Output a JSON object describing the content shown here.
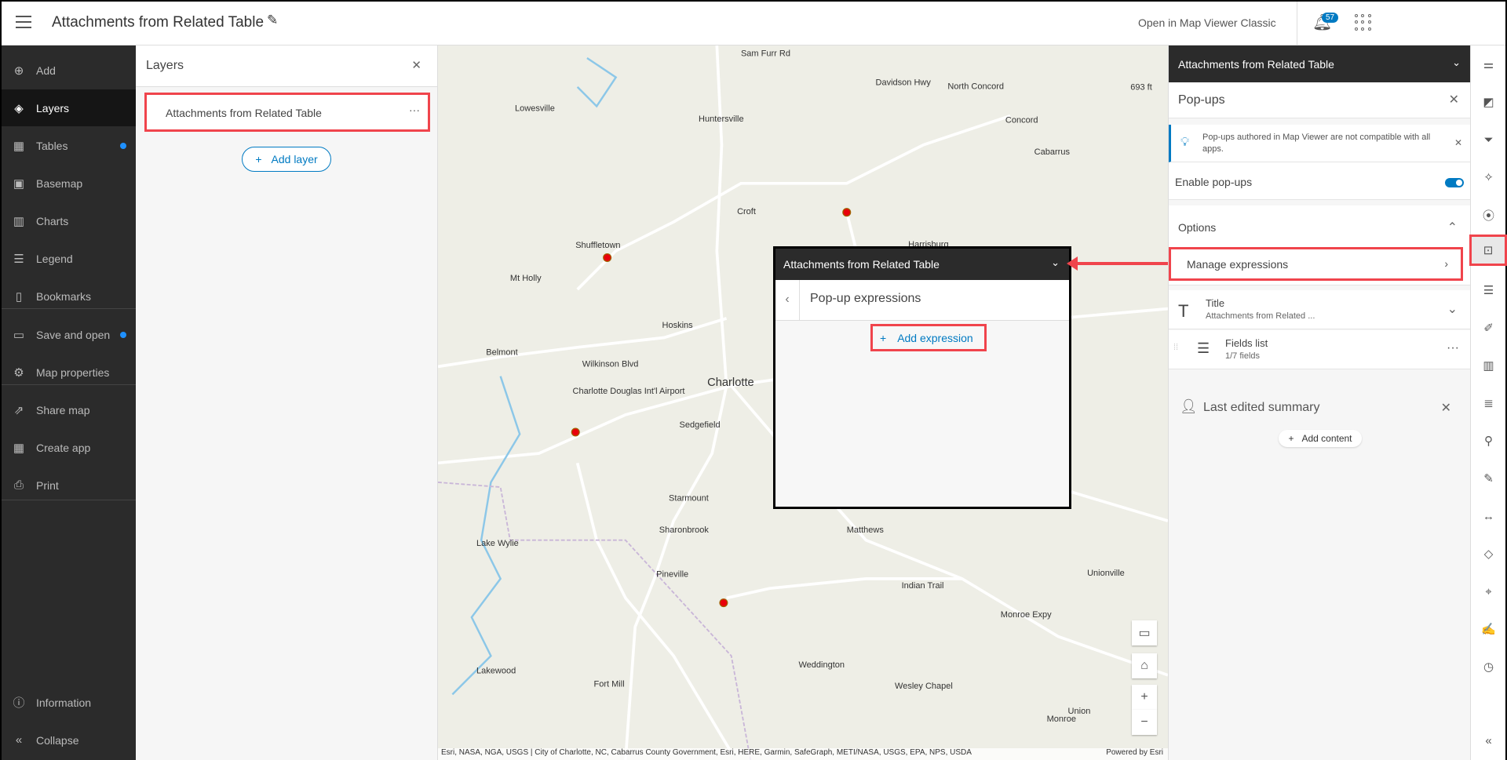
{
  "header": {
    "title": "Attachments from Related Table",
    "classic_link": "Open in Map Viewer Classic",
    "notification_count": "57"
  },
  "nav": {
    "items": [
      {
        "label": "Add",
        "icon": "⊕"
      },
      {
        "label": "Layers",
        "icon": "◈",
        "active": true
      },
      {
        "label": "Tables",
        "icon": "▦",
        "dot": true
      },
      {
        "label": "Basemap",
        "icon": "▣"
      },
      {
        "label": "Charts",
        "icon": "▥"
      },
      {
        "label": "Legend",
        "icon": "☰"
      },
      {
        "label": "Bookmarks",
        "icon": "▯"
      },
      {
        "label": "Save and open",
        "icon": "▭",
        "dot": true
      },
      {
        "label": "Map properties",
        "icon": "⚙"
      },
      {
        "label": "Share map",
        "icon": "⇗"
      },
      {
        "label": "Create app",
        "icon": "▦"
      },
      {
        "label": "Print",
        "icon": "⎙"
      }
    ],
    "information": "Information",
    "collapse": "Collapse"
  },
  "layers_panel": {
    "title": "Layers",
    "layer_name": "Attachments from Related Table",
    "add_layer": "Add layer"
  },
  "map": {
    "labels": [
      "Sam Furr Rd",
      "Davidson Hwy",
      "North Concord",
      "Lowesville",
      "Huntersville",
      "Concord",
      "Cabarrus",
      "Croft",
      "Shuffletown",
      "Mt Holly",
      "Harrisburg",
      "Hoskins",
      "Belmont",
      "Charlotte",
      "Charlotte Douglas Int'l Airport",
      "Sedgefield",
      "Starmount",
      "Sharonbrook",
      "Matthews",
      "Lake Wylie",
      "Pineville",
      "Indian Trail",
      "Unionville",
      "Lakewood",
      "Weddington",
      "Wesley Chapel",
      "Fort Mill",
      "Monroe",
      "Union",
      "693 ft",
      "Wilkinson Blvd",
      "Monroe Expy"
    ],
    "attribution": "Esri, NASA, NGA, USGS | City of Charlotte, NC, Cabarrus County Government, Esri, HERE, Garmin, SafeGraph, METI/NASA, USGS, EPA, NPS, USDA",
    "powered_by": "Powered by Esri",
    "point_color": "#e8000b"
  },
  "popup": {
    "title": "Attachments from Related Table",
    "subtitle": "Pop-up expressions",
    "add_expression": "Add expression"
  },
  "right_panel": {
    "layer_title": "Attachments from Related Table",
    "section": "Pop-ups",
    "notice": "Pop-ups authored in Map Viewer are not compatible with all apps.",
    "enable": "Enable pop-ups",
    "enable_on": true,
    "options": "Options",
    "manage_expressions": "Manage expressions",
    "title_label": "Title",
    "title_value": "Attachments from Related ...",
    "fields_label": "Fields list",
    "fields_value": "1/7 fields",
    "last_edited": "Last edited summary",
    "add_content": "Add content"
  },
  "colors": {
    "accent": "#007ac2",
    "highlight": "#f0444c",
    "dark": "#2b2b2b"
  }
}
